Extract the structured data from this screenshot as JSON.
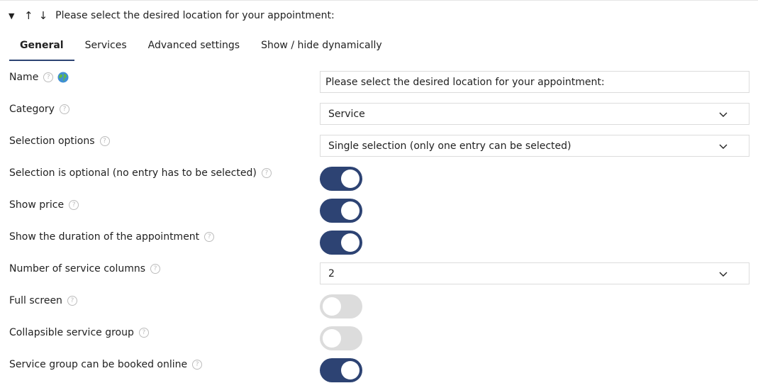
{
  "header": {
    "collapse_glyph": "▼",
    "move_up_glyph": "↑",
    "move_down_glyph": "↓",
    "title": "Please select the desired location for your appointment:"
  },
  "tabs": [
    {
      "label": "General",
      "active": true
    },
    {
      "label": "Services",
      "active": false
    },
    {
      "label": "Advanced settings",
      "active": false
    },
    {
      "label": "Show / hide dynamically",
      "active": false
    }
  ],
  "help_glyph": "?",
  "fields": {
    "name": {
      "label": "Name",
      "value": "Please select the desired location for your appointment:"
    },
    "category": {
      "label": "Category",
      "value": "Service"
    },
    "selection_options": {
      "label": "Selection options",
      "value": "Single selection (only one entry can be selected)"
    },
    "selection_optional": {
      "label": "Selection is optional (no entry has to be selected)",
      "on": true
    },
    "show_price": {
      "label": "Show price",
      "on": true
    },
    "show_duration": {
      "label": "Show the duration of the appointment",
      "on": true
    },
    "service_columns": {
      "label": "Number of service columns",
      "value": "2"
    },
    "full_screen": {
      "label": "Full screen",
      "on": false
    },
    "collapsible_group": {
      "label": "Collapsible service group",
      "on": false
    },
    "group_bookable": {
      "label": "Service group can be booked online",
      "on": true
    }
  },
  "colors": {
    "accent": "#2d4373",
    "toggle_off": "#dcdcdc",
    "border": "#dcdcdc"
  }
}
